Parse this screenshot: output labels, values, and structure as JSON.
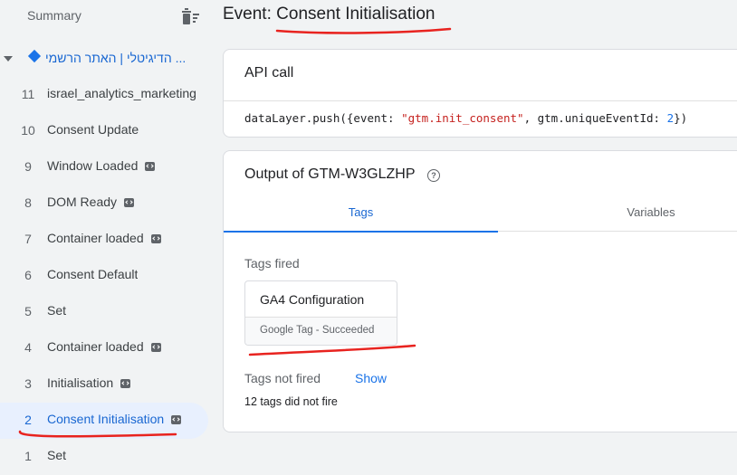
{
  "sidebar": {
    "summary_label": "Summary",
    "site_label": "הדיגיטלי | האתר הרשמי ...",
    "events": [
      {
        "num": "11",
        "label": "israel_analytics_marketing",
        "badge": false
      },
      {
        "num": "10",
        "label": "Consent Update",
        "badge": false
      },
      {
        "num": "9",
        "label": "Window Loaded",
        "badge": true
      },
      {
        "num": "8",
        "label": "DOM Ready",
        "badge": true
      },
      {
        "num": "7",
        "label": "Container loaded",
        "badge": true
      },
      {
        "num": "6",
        "label": "Consent Default",
        "badge": false
      },
      {
        "num": "5",
        "label": "Set",
        "badge": false
      },
      {
        "num": "4",
        "label": "Container loaded",
        "badge": true
      },
      {
        "num": "3",
        "label": "Initialisation",
        "badge": true
      },
      {
        "num": "2",
        "label": "Consent Initialisation",
        "badge": true,
        "active": true
      },
      {
        "num": "1",
        "label": "Set",
        "badge": false
      }
    ]
  },
  "main": {
    "title_prefix": "Event: ",
    "title_event": "Consent Initialisation",
    "api_card": {
      "heading": "API call",
      "code_pre": "dataLayer.push({event: ",
      "code_str": "\"gtm.init_consent\"",
      "code_mid": ", gtm.uniqueEventId: ",
      "code_num": "2",
      "code_post": "})"
    },
    "output_card": {
      "heading": "Output of GTM-W3GLZHP",
      "help_glyph": "?",
      "tabs": [
        "Tags",
        "Variables"
      ],
      "tags_fired_label": "Tags fired",
      "fired_tag": {
        "name": "GA4 Configuration",
        "status": "Google Tag - Succeeded"
      },
      "tags_not_fired_label": "Tags not fired",
      "show_label": "Show",
      "not_fired_text": "12 tags did not fire"
    }
  },
  "colors": {
    "accent": "#1a73e8",
    "active_bg": "#e8f0fe",
    "annotation": "#e8231f"
  }
}
